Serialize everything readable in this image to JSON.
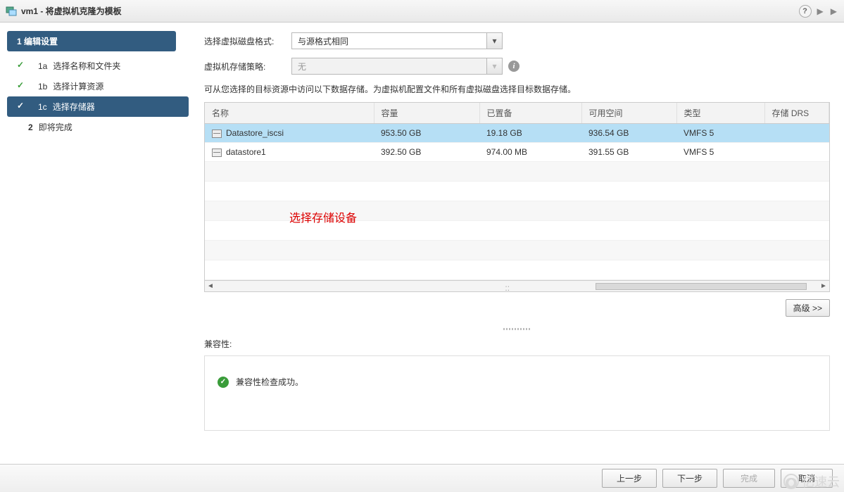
{
  "titlebar": {
    "title": "vm1 - 将虚拟机克隆为模板"
  },
  "sidebar": {
    "group1_label": "1 编辑设置",
    "steps": [
      {
        "num": "1a",
        "label": "选择名称和文件夹"
      },
      {
        "num": "1b",
        "label": "选择计算资源"
      },
      {
        "num": "1c",
        "label": "选择存储器"
      }
    ],
    "pending": {
      "num": "2",
      "label": "即将完成"
    }
  },
  "form": {
    "disk_format_label": "选择虚拟磁盘格式:",
    "disk_format_value": "与源格式相同",
    "storage_policy_label": "虚拟机存储策略:",
    "storage_policy_value": "无",
    "description": "可从您选择的目标资源中访问以下数据存储。为虚拟机配置文件和所有虚拟磁盘选择目标数据存储。"
  },
  "table": {
    "headers": [
      "名称",
      "容量",
      "已置备",
      "可用空间",
      "类型",
      "存储 DRS"
    ],
    "rows": [
      {
        "name": "Datastore_iscsi",
        "capacity": "953.50 GB",
        "provisioned": "19.18 GB",
        "free": "936.54 GB",
        "type": "VMFS 5",
        "drs": ""
      },
      {
        "name": "datastore1",
        "capacity": "392.50 GB",
        "provisioned": "974.00 MB",
        "free": "391.55 GB",
        "type": "VMFS 5",
        "drs": ""
      }
    ]
  },
  "annotation": "选择存储设备",
  "advanced_button": "高级 >>",
  "compat": {
    "label": "兼容性:",
    "message": "兼容性检查成功。"
  },
  "footer": {
    "back": "上一步",
    "next": "下一步",
    "finish": "完成",
    "cancel": "取消"
  },
  "watermark": "亿速云"
}
